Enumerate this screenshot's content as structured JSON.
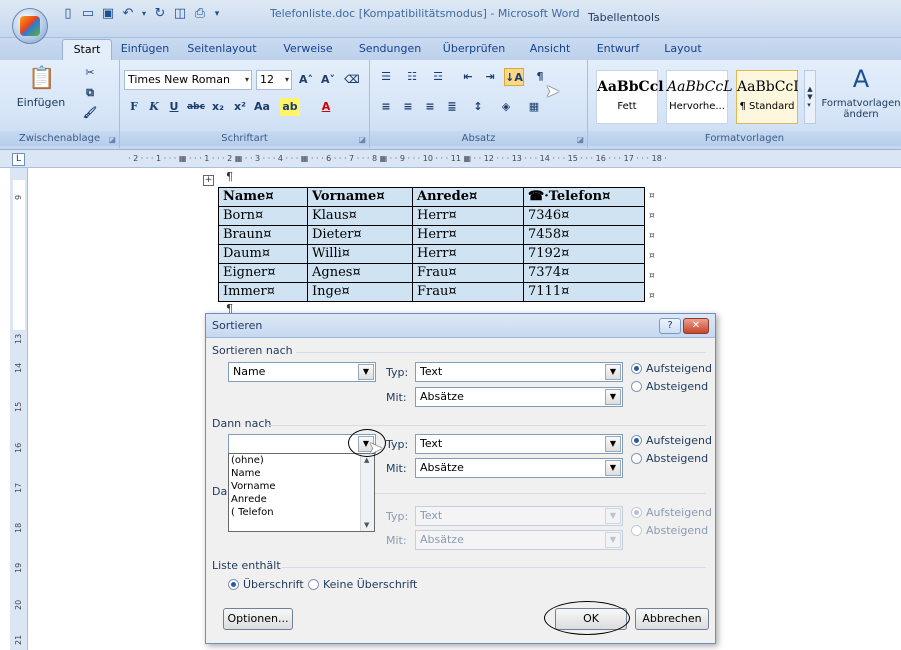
{
  "window": {
    "title": "Telefonliste.doc [Kompatibilitätsmodus] - Microsoft Word",
    "context_group": "Tabellentools"
  },
  "tabs": {
    "start": "Start",
    "einfuegen": "Einfügen",
    "seitenlayout": "Seitenlayout",
    "verweise": "Verweise",
    "sendungen": "Sendungen",
    "ueberpruefen": "Überprüfen",
    "ansicht": "Ansicht",
    "entwurf": "Entwurf",
    "layout": "Layout"
  },
  "ribbon": {
    "clipboard": {
      "label": "Zwischenablage",
      "paste": "Einfügen"
    },
    "font": {
      "label": "Schriftart",
      "name": "Times New Roman",
      "size": "12"
    },
    "paragraph": {
      "label": "Absatz"
    },
    "styles": {
      "label": "Formatvorlagen",
      "tiles": [
        {
          "sample": "AaBbCcl",
          "name": "Fett"
        },
        {
          "sample": "AaBbCcL",
          "name": "Hervorhe..."
        },
        {
          "sample": "AaBbCcI",
          "name": "¶ Standard"
        }
      ],
      "change": "Formatvorlagen ändern"
    }
  },
  "ruler": {
    "scale": "· 2 · · · 1 · · · ▦ · · · 1 · · · 2 ▦ · · 3 · · · 4 · · · ▦ · · · 6 · · · 7 · · · 8 ▦ · · 9 · · · 10 · · · 11 ▦ · · 12 · · · 13 · · · 14 · · · 15 · · · 16 · · · 17 · · · 18 ·",
    "vertical": [
      "9",
      "13",
      "14",
      "15",
      "16",
      "17",
      "18",
      "19",
      "20",
      "21"
    ]
  },
  "table": {
    "headers": [
      "Name¤",
      "Vorname¤",
      "Anrede¤",
      "☎·Telefon¤"
    ],
    "rows": [
      [
        "Born¤",
        "Klaus¤",
        "Herr¤",
        "7346¤"
      ],
      [
        "Braun¤",
        "Dieter¤",
        "Herr¤",
        "7458¤"
      ],
      [
        "Daum¤",
        "Willi¤",
        "Herr¤",
        "7192¤"
      ],
      [
        "Eigner¤",
        "Agnes¤",
        "Frau¤",
        "7374¤"
      ],
      [
        "Immer¤",
        "Inge¤",
        "Frau¤",
        "7111¤"
      ]
    ],
    "end_mark": "¤"
  },
  "dialog": {
    "title": "Sortieren",
    "help": "?",
    "close": "✕",
    "sort_by": {
      "label": "Sortieren nach",
      "field": "Name",
      "typ_label": "Typ:",
      "typ_value": "Text",
      "mit_label": "Mit:",
      "mit_value": "Absätze",
      "asc": "Aufsteigend",
      "desc": "Absteigend"
    },
    "then_by": {
      "label": "Dann nach",
      "field": "",
      "typ_label": "Typ:",
      "typ_value": "Text",
      "mit_label": "Mit:",
      "mit_value": "Absätze",
      "asc": "Aufsteigend",
      "desc": "Absteigend"
    },
    "then_by2": {
      "label": "Dann nach",
      "typ_label": "Typ:",
      "typ_value": "Text",
      "mit_label": "Mit:",
      "mit_value": "Absätze",
      "asc": "Aufsteigend",
      "desc": "Absteigend"
    },
    "dropdown_options": [
      "(ohne)",
      "Name",
      "Vorname",
      "Anrede",
      "( Telefon"
    ],
    "list_contains": {
      "label": "Liste enthält",
      "with_header": "Überschrift",
      "no_header": "Keine Überschrift"
    },
    "options_button": "Optionen...",
    "ok_button": "OK",
    "cancel_button": "Abbrechen"
  }
}
